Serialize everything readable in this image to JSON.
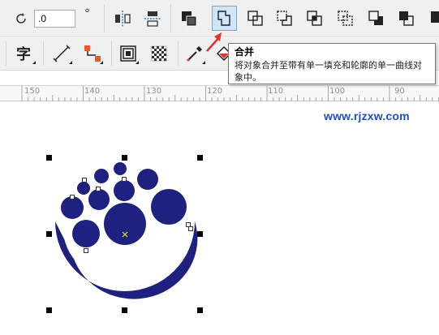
{
  "app": "CorelDRAW",
  "toolbar": {
    "rotation_value": ".0",
    "degree_symbol": "°"
  },
  "tooltip": {
    "title": "合并",
    "body": "将对象合并至带有单一填充和轮廓的单一曲线对象中。"
  },
  "ruler": {
    "labels": [
      "150",
      "140",
      "130",
      "120",
      "110",
      "100",
      "90"
    ]
  },
  "watermark": "www.rjzxw.com",
  "artwork": {
    "fill_color": "#1e2180",
    "accent_color": "#e8312d"
  }
}
